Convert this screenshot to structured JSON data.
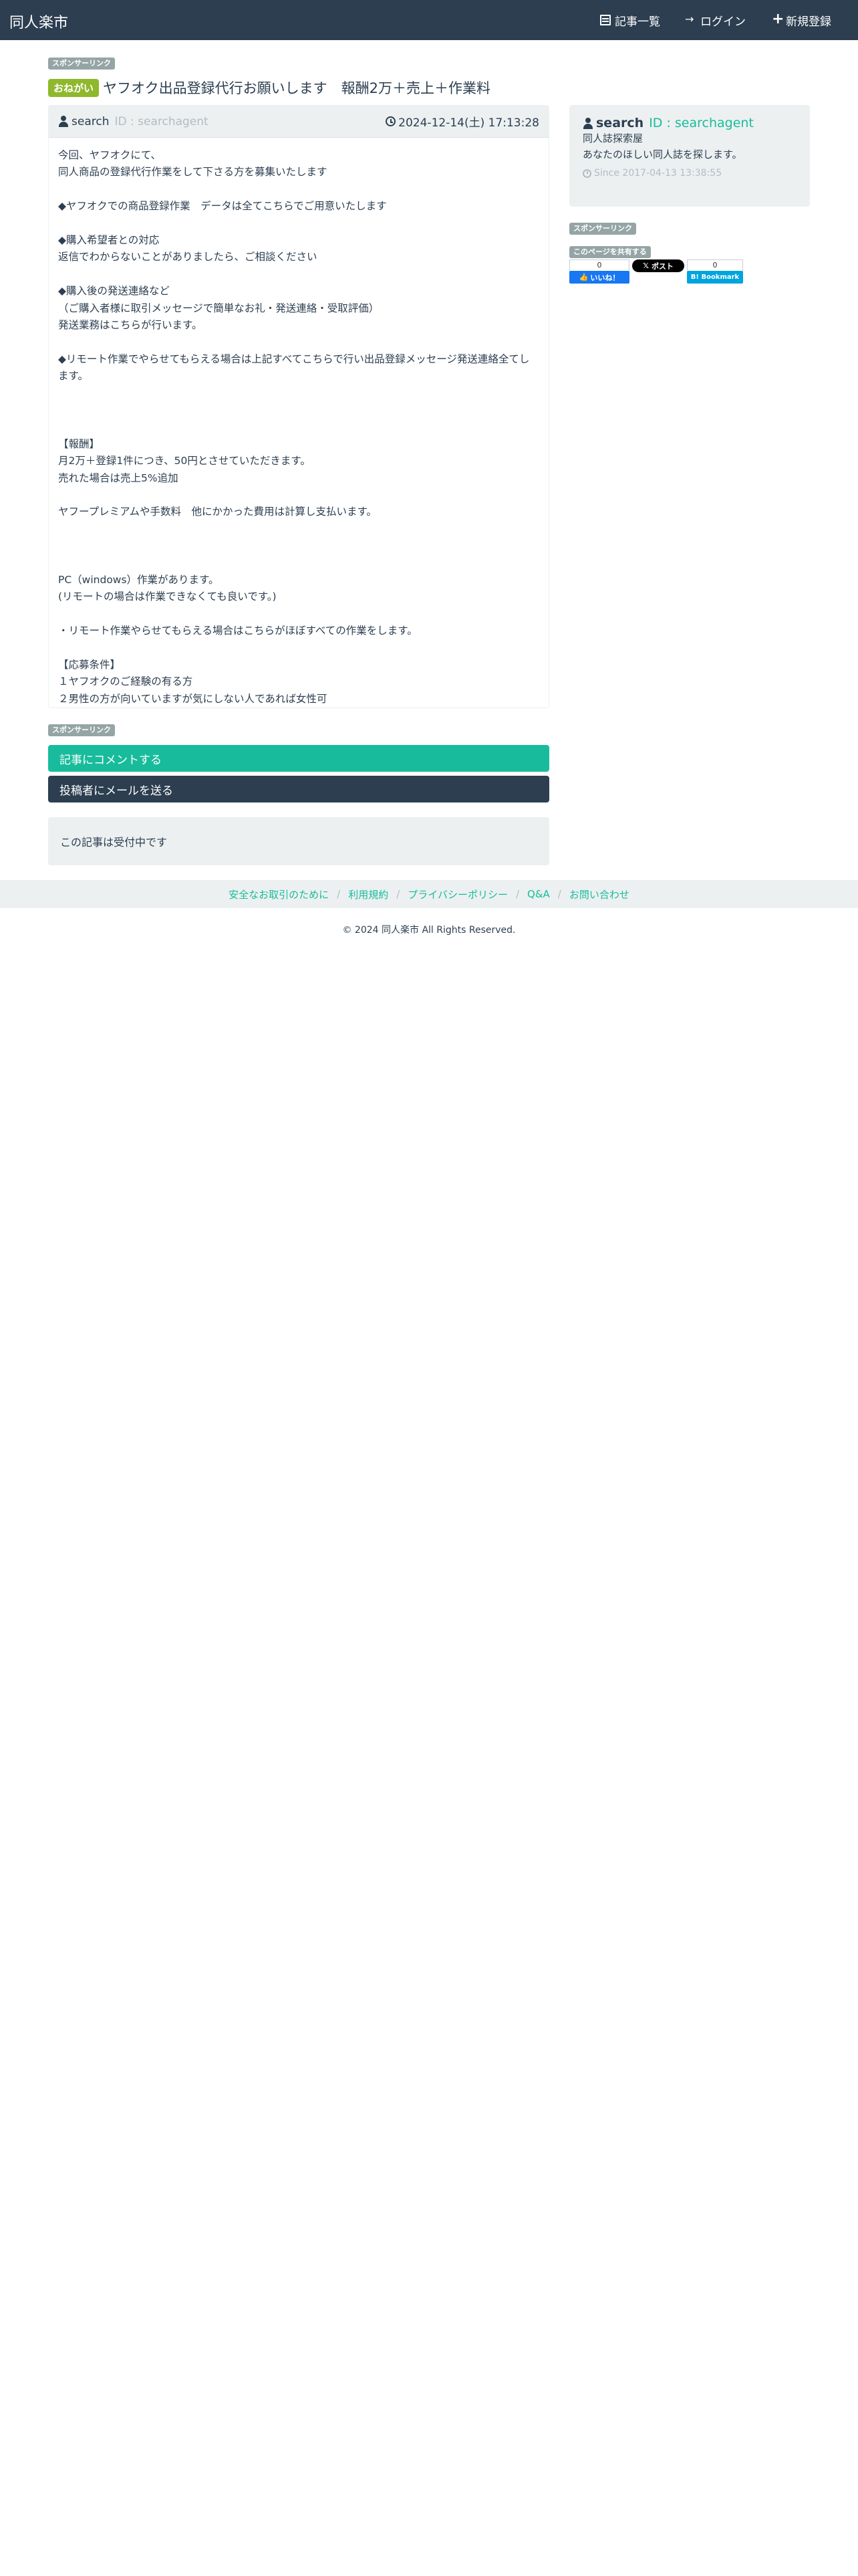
{
  "navbar": {
    "brand": "同人楽市",
    "links": [
      {
        "label": "記事一覧",
        "icon": "list-icon"
      },
      {
        "label": "ログイン",
        "icon": "login-icon"
      },
      {
        "label": "新規登録",
        "icon": "plus-icon"
      }
    ]
  },
  "sponsor_label": "スポンサーリンク",
  "post": {
    "badge": "おねがい",
    "title": "ヤフオク出品登録代行お願いします　報酬2万＋売上＋作業料",
    "author_name": "search",
    "author_id": "ID : searchagent",
    "datetime": "2024-12-14(土) 17:13:28",
    "body_lines": [
      "今回、ヤフオクにて、",
      "同人商品の登録代行作業をして下さる方を募集いたします",
      "",
      "◆ヤフオクでの商品登録作業　データは全てこちらでご用意いたします",
      "",
      "◆購入希望者との対応",
      "返信でわからないことがありましたら、ご相談ください",
      "",
      "◆購入後の発送連絡など",
      "（ご購入者様に取引メッセージで簡単なお礼・発送連絡・受取評価）",
      "発送業務はこちらが行います。",
      "",
      "◆リモート作業でやらせてもらえる場合は上記すべてこちらで行い出品登録メッセージ発送連絡全てします。",
      "",
      "",
      "",
      "【報酬】",
      "月2万＋登録1件につき、50円とさせていただきます。",
      "売れた場合は売上5%追加",
      "",
      "ヤフープレミアムや手数料　他にかかった費用は計算し支払います。",
      "",
      "",
      "",
      "PC（windows）作業があります。",
      "(リモートの場合は作業できなくても良いです。)",
      "",
      "・リモート作業やらせてもらえる場合はこちらがほぼすべての作業をします。",
      "",
      "【応募条件】",
      "１ヤフオクのご経験の有る方",
      "２男性の方が向いていますが気にしない人であれば女性可"
    ]
  },
  "actions": {
    "comment_label": "記事にコメントする",
    "mail_label": "投稿者にメールを送る"
  },
  "status_text": "この記事は受付中です",
  "sidebar": {
    "name": "search",
    "id": "ID : searchagent",
    "line1": "同人誌探索屋",
    "line2": "あなたのほしい同人誌を探します。",
    "since": "Since 2017-04-13 13:38:55",
    "share_label": "このページを共有する",
    "fb_count": "0",
    "fb_label": "いいね！",
    "x_label": "ポスト",
    "hb_count": "0",
    "hb_label": "B! Bookmark"
  },
  "footer": {
    "links": [
      "安全なお取引のために",
      "利用規約",
      "プライバシーポリシー",
      "Q&A",
      "お問い合わせ"
    ],
    "copyright": "© 2024 同人楽市 All Rights Reserved."
  }
}
